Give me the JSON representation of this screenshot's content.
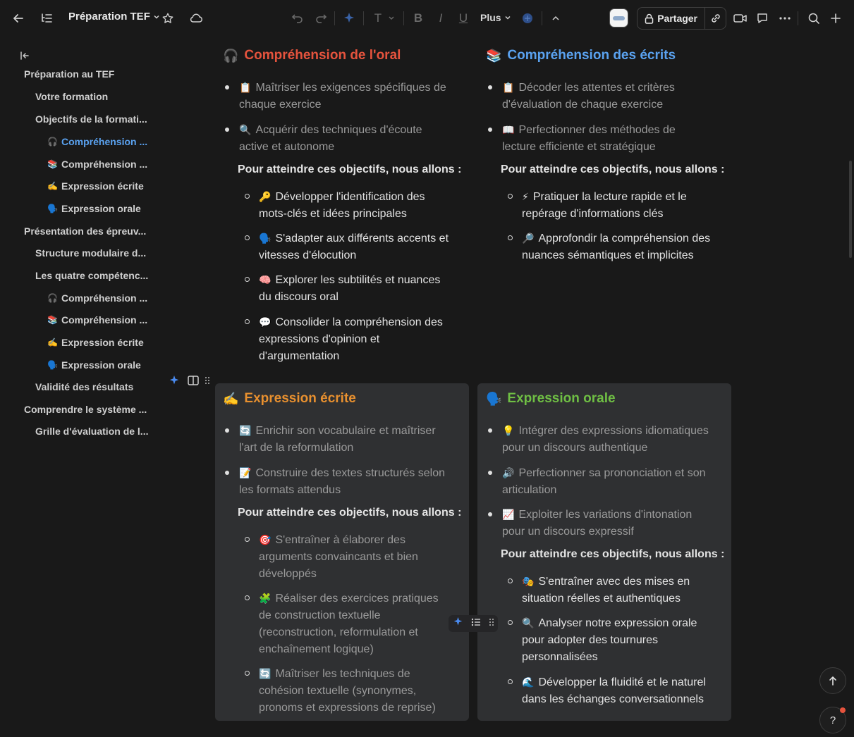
{
  "toolbar": {
    "doc_title": "Préparation TEF",
    "plus_label": "Plus",
    "share_label": "Partager",
    "format_text": "T",
    "format_bold": "B",
    "format_italic": "I",
    "format_underline": "U",
    "accent": "#5aa2f0"
  },
  "sidebar": {
    "items": [
      {
        "label": "Préparation au TEF",
        "level": 0
      },
      {
        "label": "Votre formation",
        "level": 1
      },
      {
        "label": "Objectifs de la formati...",
        "level": 1
      },
      {
        "label": "Compréhension ...",
        "level": 2,
        "icon": "🎧",
        "active": true
      },
      {
        "label": "Compréhension ...",
        "level": 2,
        "icon": "📚"
      },
      {
        "label": "Expression écrite",
        "level": 2,
        "icon": "✍️"
      },
      {
        "label": "Expression orale",
        "level": 2,
        "icon": "🗣️"
      },
      {
        "label": "Présentation des épreuv...",
        "level": 0
      },
      {
        "label": "Structure modulaire d...",
        "level": 1
      },
      {
        "label": "Les quatre compétenc...",
        "level": 1
      },
      {
        "label": "Compréhension ...",
        "level": 2,
        "icon": "🎧"
      },
      {
        "label": "Compréhension ...",
        "level": 2,
        "icon": "📚"
      },
      {
        "label": "Expression écrite",
        "level": 2,
        "icon": "✍️"
      },
      {
        "label": "Expression orale",
        "level": 2,
        "icon": "🗣️"
      },
      {
        "label": "Validité des résultats",
        "level": 1
      },
      {
        "label": "Comprendre le système ...",
        "level": 0
      },
      {
        "label": "Grille d'évaluation de l...",
        "level": 1
      }
    ]
  },
  "sections": {
    "oral": {
      "icon": "🎧",
      "title": "Compréhension de l'oral",
      "bullets": [
        {
          "icon": "📋",
          "line1": "Maîtriser les exigences spécifiques de",
          "line2": "chaque exercice"
        },
        {
          "icon": "🔍",
          "line1": "Acquérir des techniques d'écoute",
          "line2": "active et autonome"
        }
      ],
      "intro": "Pour atteindre ces objectifs, nous allons :",
      "sub": [
        {
          "icon": "🔑",
          "lines": [
            "Développer l'identification des",
            "mots-clés et idées principales"
          ]
        },
        {
          "icon": "🗣️",
          "lines": [
            "S'adapter aux différents accents et",
            "vitesses d'élocution"
          ]
        },
        {
          "icon": "🧠",
          "lines": [
            "Explorer les subtilités et nuances",
            "du discours oral"
          ]
        },
        {
          "icon": "💬",
          "lines": [
            "Consolider la compréhension des",
            "expressions d'opinion et",
            "d'argumentation"
          ]
        }
      ]
    },
    "ecrits": {
      "icon": "📚",
      "title": "Compréhension des écrits",
      "bullets": [
        {
          "icon": "📋",
          "line1": "Décoder les attentes et critères",
          "line2": "d'évaluation de chaque exercice"
        },
        {
          "icon": "📖",
          "line1": "Perfectionner des méthodes de",
          "line2": "lecture efficiente et stratégique"
        }
      ],
      "intro": "Pour atteindre ces objectifs, nous allons :",
      "sub": [
        {
          "icon": "⚡",
          "lines": [
            "Pratiquer la lecture rapide et le",
            "repérage d'informations clés"
          ]
        },
        {
          "icon": "🔎",
          "lines": [
            "Approfondir la compréhension des",
            "nuances sémantiques et implicites"
          ]
        }
      ]
    },
    "ecrite": {
      "icon": "✍️",
      "title": "Expression écrite",
      "bullets": [
        {
          "icon": "🔄",
          "line1": "Enrichir son vocabulaire et maîtriser",
          "line2": "l'art de la reformulation"
        },
        {
          "icon": "📝",
          "line1": "Construire des textes structurés selon",
          "line2": "les formats attendus"
        }
      ],
      "intro": "Pour atteindre ces objectifs, nous allons :",
      "sub": [
        {
          "icon": "🎯",
          "lines": [
            "S'entraîner à élaborer des",
            "arguments convaincants et bien",
            "développés"
          ]
        },
        {
          "icon": "🧩",
          "lines": [
            "Réaliser des exercices pratiques",
            "de construction textuelle",
            "(reconstruction, reformulation et",
            "enchaînement logique)"
          ]
        },
        {
          "icon": "🔄",
          "lines": [
            "Maîtriser les techniques de",
            "cohésion textuelle (synonymes,",
            "pronoms et expressions de reprise)"
          ]
        }
      ]
    },
    "orale": {
      "icon": "🗣️",
      "title": "Expression orale",
      "bullets": [
        {
          "icon": "💡",
          "line1": "Intégrer des expressions idiomatiques",
          "line2": "pour un discours authentique"
        },
        {
          "icon": "🔊",
          "line1": "Perfectionner sa prononciation et son",
          "line2": "articulation"
        },
        {
          "icon": "📈",
          "line1": "Exploiter les variations d'intonation",
          "line2": "pour un discours expressif"
        }
      ],
      "intro": "Pour atteindre ces objectifs, nous allons :",
      "sub": [
        {
          "icon": "🎭",
          "lines": [
            "S'entraîner avec des mises en",
            "situation réelles et authentiques"
          ]
        },
        {
          "icon": "🔍",
          "lines": [
            "Analyser notre expression orale",
            "pour adopter des tournures",
            "personnalisées"
          ]
        },
        {
          "icon": "🌊",
          "lines": [
            "Développer la fluidité et le naturel",
            "dans les échanges conversationnels"
          ]
        }
      ]
    }
  },
  "help_label": "?"
}
